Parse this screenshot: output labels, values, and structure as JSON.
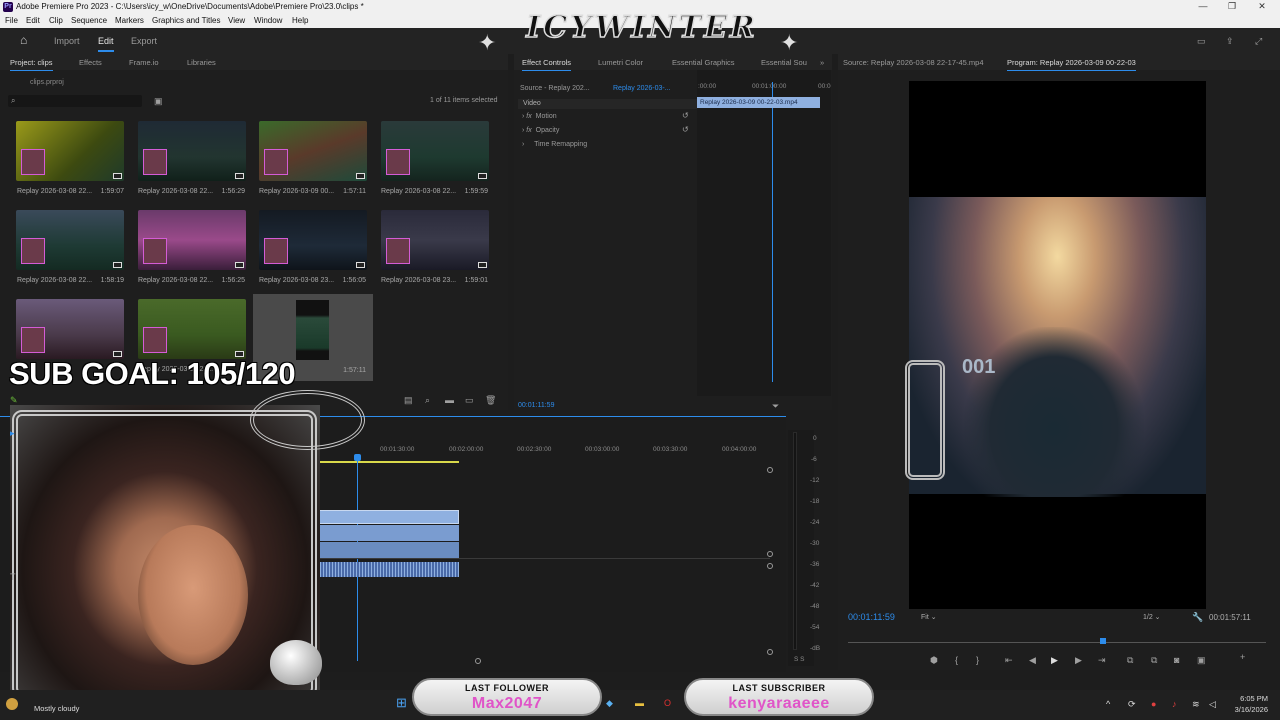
{
  "window": {
    "title": "Adobe Premiere Pro 2023 - C:\\Users\\icy_w\\OneDrive\\Documents\\Adobe\\Premiere Pro\\23.0\\clips *",
    "minimize": "—",
    "restore": "❐",
    "close": "✕"
  },
  "menu": [
    "File",
    "Edit",
    "Clip",
    "Sequence",
    "Markers",
    "Graphics and Titles",
    "View",
    "Window",
    "Help"
  ],
  "header": {
    "home": "⌂",
    "tabs": [
      "Import",
      "Edit",
      "Export"
    ]
  },
  "project": {
    "tabs": [
      "Project: clips",
      "Effects",
      "Frame.io",
      "Libraries"
    ],
    "folder": "clips.prproj",
    "selection_count": "1 of 11 items selected",
    "clips": [
      {
        "name": "Replay 2026-03-08 22...",
        "duration": "1:59:07"
      },
      {
        "name": "Replay 2026-03-08 22...",
        "duration": "1:56:29"
      },
      {
        "name": "Replay 2026-03-09 00...",
        "duration": "1:57:11"
      },
      {
        "name": "Replay 2026-03-08 22...",
        "duration": "1:59:59"
      },
      {
        "name": "Replay 2026-03-08 22...",
        "duration": "1:58:19"
      },
      {
        "name": "Replay 2026-03-08 22...",
        "duration": "1:56:25"
      },
      {
        "name": "Replay 2026-03-08 23...",
        "duration": "1:56:05"
      },
      {
        "name": "Replay 2026-03-08 23...",
        "duration": "1:59:01"
      },
      {
        "name": "",
        "duration": ""
      },
      {
        "name": "Replay 2026-03-08 23...",
        "duration": ""
      },
      {
        "name": "",
        "duration": "1:57:11"
      }
    ]
  },
  "effect_controls": {
    "tabs": [
      "Effect Controls",
      "Lumetri Color",
      "Essential Graphics",
      "Essential Sou"
    ],
    "source": "Source - Replay 202...",
    "sequence": "Replay 2026-03-...",
    "section": "Video",
    "items": [
      "Motion",
      "Opacity",
      "Time Remapping"
    ],
    "fx": "fx",
    "ruler": [
      ":00:00",
      "00:01:00:00",
      "00:0"
    ],
    "clip_label": "Replay 2026-03-09 00-22-03.mp4",
    "timecode": "00:01:11:59"
  },
  "monitor": {
    "source_tab": "Source: Replay 2026-03-08 22-17-45.mp4",
    "program_tab": "Program: Replay 2026-03-09 00-22-03",
    "timecode": "00:01:11:59",
    "zoom": "Fit",
    "resolution": "1/2",
    "duration": "00:01:57:11",
    "jersey": "001"
  },
  "timeline": {
    "ruler": [
      "00:01:30:00",
      "00:02:00:00",
      "00:02:30:00",
      "00:03:00:00",
      "00:03:30:00",
      "00:04:00:00"
    ],
    "meter": [
      "0",
      "-6",
      "-12",
      "-18",
      "-24",
      "-30",
      "-36",
      "-42",
      "-48",
      "-54",
      "-dB"
    ],
    "meter_footer": "S  S"
  },
  "overlay": {
    "sub_goal": "SUB GOAL: 105/120",
    "brand": "ICYWINTER",
    "last_follower_label": "LAST FOLLOWER",
    "last_follower": "Max2047",
    "last_subscriber_label": "LAST SUBSCRIBER",
    "last_subscriber": "kenyaraaeee"
  },
  "taskbar": {
    "weather": "Mostly cloudy",
    "time": "6:05 PM",
    "date": "3/16/2026"
  },
  "colors": {
    "accent": "#2d8ceb",
    "clip": "#8fb0e0",
    "playhead": "#2d8ceb",
    "overlay_pink": "#e054c8"
  }
}
